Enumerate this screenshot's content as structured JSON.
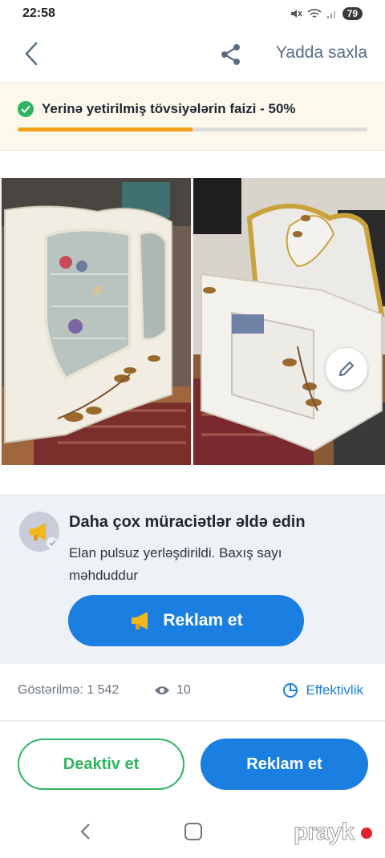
{
  "status_bar": {
    "time": "22:58",
    "battery": "79"
  },
  "header": {
    "save_label": "Yadda saxla"
  },
  "recommendations": {
    "text": "Yerinə yetirilmiş tövsiyələrin faizi - 50%",
    "progress_fraction": 0.5
  },
  "photos": [
    {
      "subject": "white glass-front display cabinet"
    },
    {
      "subject": "white sideboard with mirror"
    }
  ],
  "promo": {
    "title": "Daha çox müraciətlər əldə edin",
    "description": "Elan pulsuz yerləşdirildi. Baxış sayı məhduddur",
    "button_label": "Reklam et",
    "button_icon": "megaphone-icon"
  },
  "stats": {
    "impressions": "Göstərilmə: 1 542",
    "views": "10",
    "effectiveness_label": "Effektivlik"
  },
  "actions": {
    "deactivate_label": "Deaktiv et",
    "advertise_label": "Reklam et"
  },
  "watermark": "prayk",
  "colors": {
    "accent_blue": "#1a7fe0",
    "success_green": "#2fb463",
    "progress_orange": "#f2a218",
    "banner_bg": "#fdf8ec",
    "promo_bg": "#eef1f6"
  }
}
